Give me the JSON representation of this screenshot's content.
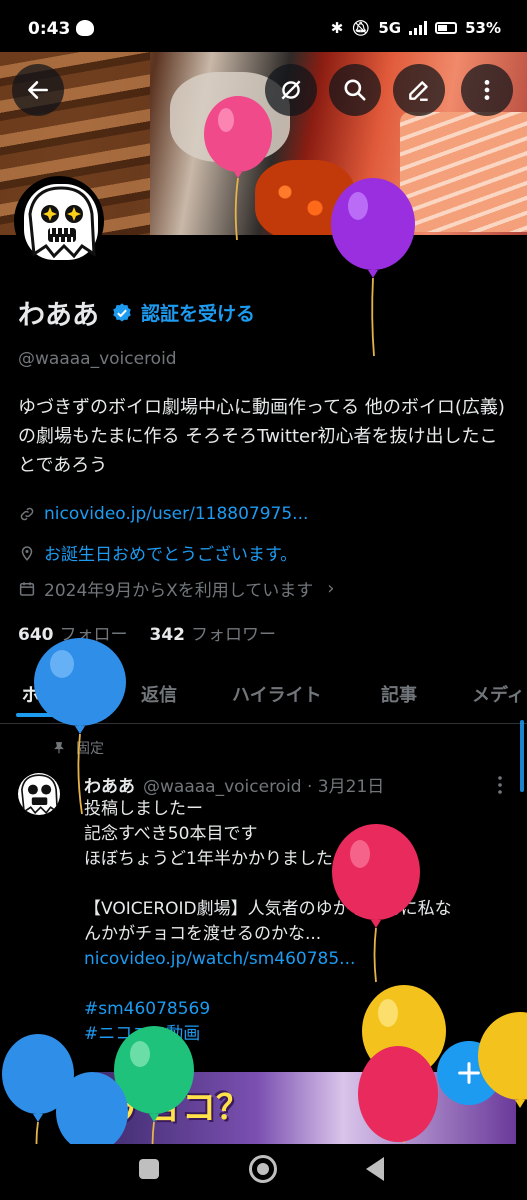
{
  "status_bar": {
    "time": "0:43",
    "network": "5G",
    "battery": "53%"
  },
  "header": {
    "back_icon": "arrow-left-icon",
    "actions": [
      "grok-icon",
      "search-icon",
      "edit-icon",
      "more-vertical-icon"
    ]
  },
  "profile": {
    "display_name": "わああ",
    "verify_link": "認証を受ける",
    "handle": "@waaaa_voiceroid",
    "bio": "ゆづきずのボイロ劇場中心に動画作ってる 他のボイロ(広義)の劇場もたまに作る そろそろTwitter初心者を抜け出したことであろう",
    "website": "nicovideo.jp/user/118807975...",
    "location": "お誕生日おめでとうございます。",
    "joined": "2024年9月からXを利用しています",
    "following_count": "640",
    "following_label": "フォロー",
    "followers_count": "342",
    "followers_label": "フォロワー"
  },
  "tabs": [
    "ポスト",
    "返信",
    "ハイライト",
    "記事",
    "メディ"
  ],
  "pinned_label": "固定",
  "tweet": {
    "author": "わああ",
    "handle_date": "@waaaa_voiceroid · 3月21日",
    "line1": "投稿しましたー",
    "line2": "記念すべき50本目です",
    "line3": "ほぼちょうど1年半かかりました",
    "line4": "【VOICEROID劇場】人気者のゆかりさんに私な",
    "line5": "んかがチョコを渡せるのかな...",
    "link": "nicovideo.jp/watch/sm460785...",
    "tag1": "#sm46078569",
    "tag2": "#ニコニコ動画",
    "thumb_text": "チョコ？"
  },
  "colors": {
    "accent": "#1d9bf0",
    "background": "#000000",
    "text_primary": "#e7e9ea",
    "text_secondary": "#71767b"
  },
  "overlays": [
    "balloon-pink",
    "balloon-purple",
    "balloon-blue",
    "balloon-red",
    "balloon-yellow",
    "balloon-green"
  ]
}
